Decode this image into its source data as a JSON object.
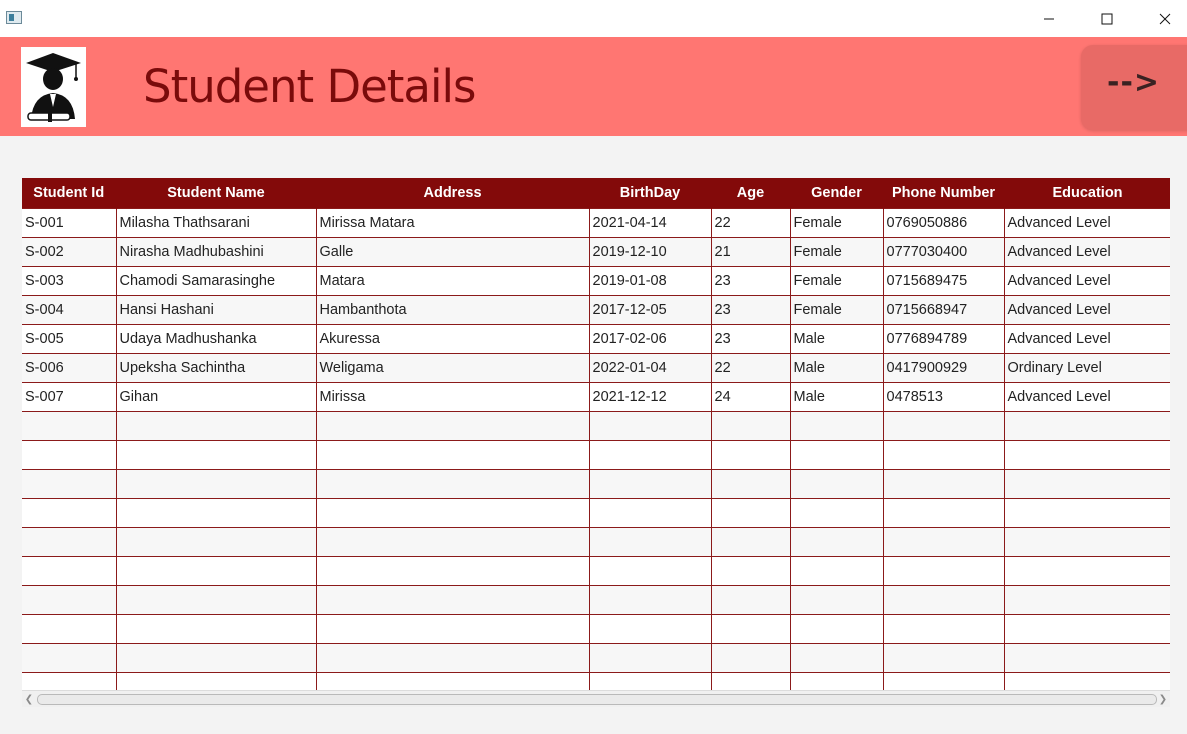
{
  "window": {
    "controls": {
      "minimize": "—",
      "maximize": "☐",
      "close": "✕"
    }
  },
  "header": {
    "title": "Student Details",
    "next_label": "-->",
    "logo_icon": "graduate-icon",
    "background": "#ff7672",
    "title_color": "#7a0b0b"
  },
  "table": {
    "header_color": "#830a0a",
    "columns": [
      "Student Id",
      "Student Name",
      "Address",
      "BirthDay",
      "Age",
      "Gender",
      "Phone Number",
      "Education"
    ],
    "rows": [
      [
        "S-001",
        "Milasha Thathsarani",
        "Mirissa Matara",
        "2021-04-14",
        "22",
        "Female",
        "0769050886",
        "Advanced Level"
      ],
      [
        "S-002",
        "Nirasha Madhubashini",
        "Galle",
        "2019-12-10",
        "21",
        "Female",
        "0777030400",
        "Advanced Level"
      ],
      [
        "S-003",
        "Chamodi Samarasinghe",
        "Matara",
        "2019-01-08",
        "23",
        "Female",
        "0715689475",
        "Advanced Level"
      ],
      [
        "S-004",
        "Hansi Hashani",
        "Hambanthota",
        "2017-12-05",
        "23",
        "Female",
        "0715668947",
        "Advanced Level"
      ],
      [
        "S-005",
        "Udaya Madhushanka",
        "Akuressa",
        "2017-02-06",
        "23",
        "Male",
        "0776894789",
        "Advanced Level"
      ],
      [
        "S-006",
        "Upeksha Sachintha",
        "Weligama",
        "2022-01-04",
        "22",
        "Male",
        "0417900929",
        "Ordinary Level"
      ],
      [
        "S-007",
        "Gihan",
        "Mirissa",
        "2021-12-12",
        "24",
        "Male",
        "0478513",
        "Advanced Level"
      ]
    ]
  },
  "scrollbar": {
    "left_arrow": "❮",
    "right_arrow": "❯"
  }
}
